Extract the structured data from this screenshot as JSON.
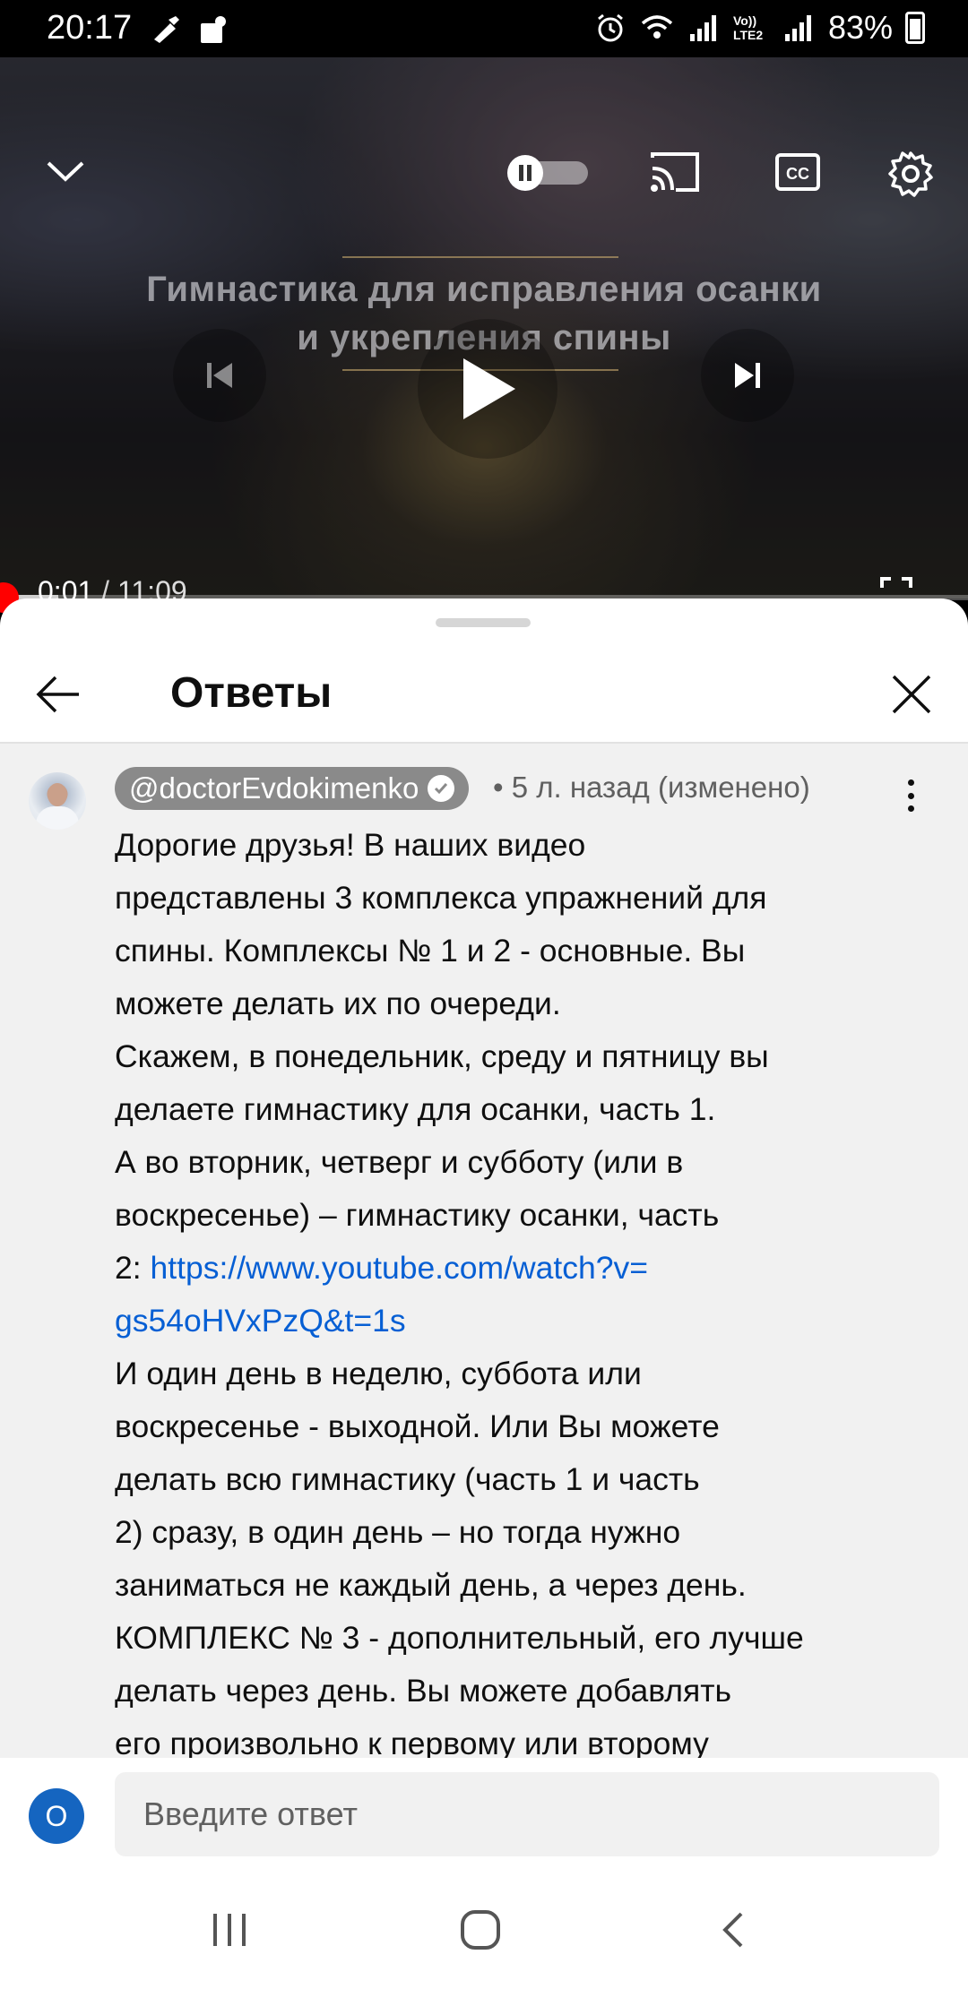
{
  "status_bar": {
    "time": "20:17",
    "left_icons": [
      "cleaner-icon",
      "notification-icon"
    ],
    "right_icons": [
      "alarm-icon",
      "wifi-icon",
      "signal-icon",
      "volte-icon",
      "signal-icon"
    ],
    "volte_label": "Vo)) LTE2",
    "battery": "83%"
  },
  "video": {
    "title_line1": "Гимнастика для исправления осанки",
    "title_line2": "и укрепления спины",
    "current_time": "0:01",
    "separator": " / ",
    "duration": "11:09",
    "progress_fraction": 0.0015,
    "buffer_fraction": 0.06
  },
  "panel": {
    "title": "Ответы"
  },
  "comment": {
    "author": "@doctorEvdokimenko",
    "meta": "• 5 л. назад (изменено)",
    "text_before_link": "Дорогие друзья! В наших видео\nпредставлены 3 комплекса упражнений для\nспины. Комплексы № 1 и 2 - основные. Вы\nможете делать их по очереди.\nСкажем, в понедельник, среду и пятницу вы\nделаете гимнастику для осанки, часть 1.\nА во вторник, четверг и субботу (или в\nвоскресенье) – гимнастику осанки, часть\n2: ",
    "link": "https://www.youtube.com/watch?v=\ngs54oHVxPzQ&t=1s",
    "text_after_link": "\nИ один день в неделю, суббота или\nвоскресенье - выходной. Или Вы можете\nделать всю гимнастику (часть 1 и часть\n2) сразу, в один день – но тогда нужно\nзаниматься не каждый день, а через день.\nКОМПЛЕКС № 3 - дополнительный, его лучше\nделать через день. Вы можете добавлять\nего произвольно к первому или второму"
  },
  "reply": {
    "avatar_letter": "О",
    "placeholder": "Введите ответ"
  },
  "colors": {
    "link": "#065fd4",
    "progress": "#ff0000",
    "avatar": "#1565c0"
  }
}
